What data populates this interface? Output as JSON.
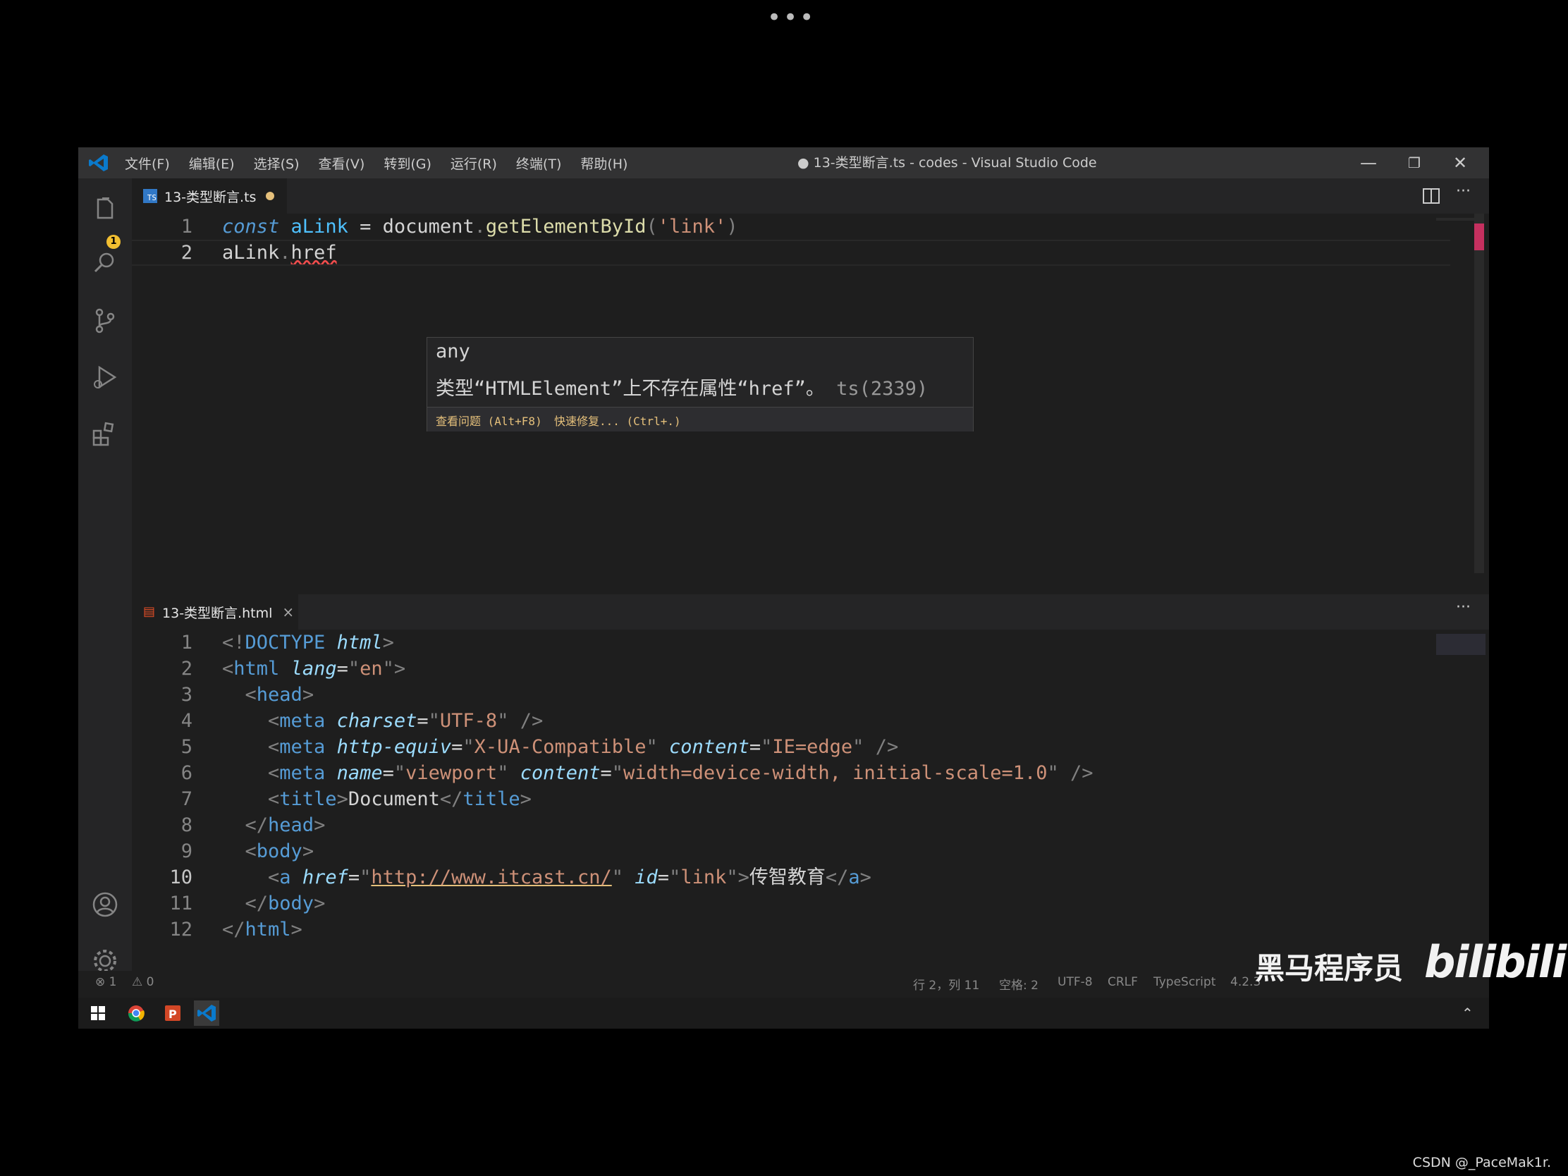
{
  "overlay": {
    "dots": "•••"
  },
  "titlebar": {
    "menu": [
      "文件(F)",
      "编辑(E)",
      "选择(S)",
      "查看(V)",
      "转到(G)",
      "运行(R)",
      "终端(T)",
      "帮助(H)"
    ],
    "title": "● 13-类型断言.ts - codes - Visual Studio Code",
    "minimize": "—",
    "restore": "❐",
    "close": "✕"
  },
  "activity": {
    "badge": "1"
  },
  "editor_top": {
    "tab_icon": "TS",
    "tab_name": "13-类型断言.ts",
    "lines": [
      {
        "num": "1",
        "tokens": [
          {
            "t": "const",
            "c": "kw"
          },
          {
            "t": " ",
            "c": "plain"
          },
          {
            "t": "aLink",
            "c": "var"
          },
          {
            "t": " = ",
            "c": "plain"
          },
          {
            "t": "document",
            "c": "plain"
          },
          {
            "t": ".",
            "c": "punc"
          },
          {
            "t": "getElementById",
            "c": "fn"
          },
          {
            "t": "(",
            "c": "punc"
          },
          {
            "t": "'link'",
            "c": "str"
          },
          {
            "t": ")",
            "c": "punc"
          }
        ]
      },
      {
        "num": "2",
        "tokens": [
          {
            "t": "aLink",
            "c": "plain"
          },
          {
            "t": ".",
            "c": "punc"
          },
          {
            "t": "href",
            "c": "plain squig"
          }
        ]
      }
    ],
    "hover": {
      "type": "any",
      "message_prefix": "类型“HTMLElement”上不存在属性“href”。",
      "message_code": "ts(2339)",
      "action_view": "查看问题 (Alt+F8)",
      "action_fix": "快速修复... (Ctrl+.)"
    }
  },
  "editor_bottom": {
    "tab_name": "13-类型断言.html",
    "tab_close": "×",
    "lines": [
      {
        "num": "1",
        "tokens": [
          {
            "t": "<!",
            "c": "punc"
          },
          {
            "t": "DOCTYPE",
            "c": "tag"
          },
          {
            "t": " ",
            "c": "plain"
          },
          {
            "t": "html",
            "c": "attr"
          },
          {
            "t": ">",
            "c": "punc"
          }
        ]
      },
      {
        "num": "2",
        "tokens": [
          {
            "t": "<",
            "c": "punc"
          },
          {
            "t": "html",
            "c": "tag"
          },
          {
            "t": " ",
            "c": "plain"
          },
          {
            "t": "lang",
            "c": "attr"
          },
          {
            "t": "=",
            "c": "plain"
          },
          {
            "t": "\"",
            "c": "punc"
          },
          {
            "t": "en",
            "c": "str"
          },
          {
            "t": "\"",
            "c": "punc"
          },
          {
            "t": ">",
            "c": "punc"
          }
        ]
      },
      {
        "num": "3",
        "tokens": [
          {
            "t": "  <",
            "c": "punc"
          },
          {
            "t": "head",
            "c": "tag"
          },
          {
            "t": ">",
            "c": "punc"
          }
        ]
      },
      {
        "num": "4",
        "tokens": [
          {
            "t": "    <",
            "c": "punc"
          },
          {
            "t": "meta",
            "c": "tag"
          },
          {
            "t": " ",
            "c": "plain"
          },
          {
            "t": "charset",
            "c": "attr"
          },
          {
            "t": "=",
            "c": "plain"
          },
          {
            "t": "\"",
            "c": "punc"
          },
          {
            "t": "UTF-8",
            "c": "str"
          },
          {
            "t": "\"",
            "c": "punc"
          },
          {
            "t": " />",
            "c": "punc"
          }
        ]
      },
      {
        "num": "5",
        "tokens": [
          {
            "t": "    <",
            "c": "punc"
          },
          {
            "t": "meta",
            "c": "tag"
          },
          {
            "t": " ",
            "c": "plain"
          },
          {
            "t": "http-equiv",
            "c": "attr"
          },
          {
            "t": "=",
            "c": "plain"
          },
          {
            "t": "\"",
            "c": "punc"
          },
          {
            "t": "X-UA-Compatible",
            "c": "str"
          },
          {
            "t": "\"",
            "c": "punc"
          },
          {
            "t": " ",
            "c": "plain"
          },
          {
            "t": "content",
            "c": "attr"
          },
          {
            "t": "=",
            "c": "plain"
          },
          {
            "t": "\"",
            "c": "punc"
          },
          {
            "t": "IE=edge",
            "c": "str"
          },
          {
            "t": "\"",
            "c": "punc"
          },
          {
            "t": " />",
            "c": "punc"
          }
        ]
      },
      {
        "num": "6",
        "tokens": [
          {
            "t": "    <",
            "c": "punc"
          },
          {
            "t": "meta",
            "c": "tag"
          },
          {
            "t": " ",
            "c": "plain"
          },
          {
            "t": "name",
            "c": "attr"
          },
          {
            "t": "=",
            "c": "plain"
          },
          {
            "t": "\"",
            "c": "punc"
          },
          {
            "t": "viewport",
            "c": "str"
          },
          {
            "t": "\"",
            "c": "punc"
          },
          {
            "t": " ",
            "c": "plain"
          },
          {
            "t": "content",
            "c": "attr"
          },
          {
            "t": "=",
            "c": "plain"
          },
          {
            "t": "\"",
            "c": "punc"
          },
          {
            "t": "width=device-width, initial-scale=1.0",
            "c": "str"
          },
          {
            "t": "\"",
            "c": "punc"
          },
          {
            "t": " />",
            "c": "punc"
          }
        ]
      },
      {
        "num": "7",
        "tokens": [
          {
            "t": "    <",
            "c": "punc"
          },
          {
            "t": "title",
            "c": "tag"
          },
          {
            "t": ">",
            "c": "punc"
          },
          {
            "t": "Document",
            "c": "plain"
          },
          {
            "t": "</",
            "c": "punc"
          },
          {
            "t": "title",
            "c": "tag"
          },
          {
            "t": ">",
            "c": "punc"
          }
        ]
      },
      {
        "num": "8",
        "tokens": [
          {
            "t": "  </",
            "c": "punc"
          },
          {
            "t": "head",
            "c": "tag"
          },
          {
            "t": ">",
            "c": "punc"
          }
        ]
      },
      {
        "num": "9",
        "tokens": [
          {
            "t": "  <",
            "c": "punc"
          },
          {
            "t": "body",
            "c": "tag"
          },
          {
            "t": ">",
            "c": "punc"
          }
        ]
      },
      {
        "num": "10",
        "tokens": [
          {
            "t": "    <",
            "c": "punc"
          },
          {
            "t": "a",
            "c": "tag"
          },
          {
            "t": " ",
            "c": "plain"
          },
          {
            "t": "href",
            "c": "attr"
          },
          {
            "t": "=",
            "c": "plain"
          },
          {
            "t": "\"",
            "c": "punc"
          },
          {
            "t": "http://www.itcast.cn/",
            "c": "url"
          },
          {
            "t": "\"",
            "c": "punc"
          },
          {
            "t": " ",
            "c": "plain"
          },
          {
            "t": "id",
            "c": "attr"
          },
          {
            "t": "=",
            "c": "plain"
          },
          {
            "t": "\"",
            "c": "punc"
          },
          {
            "t": "link",
            "c": "str"
          },
          {
            "t": "\"",
            "c": "punc"
          },
          {
            "t": ">",
            "c": "punc"
          },
          {
            "t": "传智教育",
            "c": "plain"
          },
          {
            "t": "</",
            "c": "punc"
          },
          {
            "t": "a",
            "c": "tag"
          },
          {
            "t": ">",
            "c": "punc"
          }
        ]
      },
      {
        "num": "11",
        "tokens": [
          {
            "t": "  </",
            "c": "punc"
          },
          {
            "t": "body",
            "c": "tag"
          },
          {
            "t": ">",
            "c": "punc"
          }
        ]
      },
      {
        "num": "12",
        "tokens": [
          {
            "t": "</",
            "c": "punc"
          },
          {
            "t": "html",
            "c": "tag"
          },
          {
            "t": ">",
            "c": "punc"
          }
        ]
      }
    ]
  },
  "statusbar": {
    "errors": "⊗ 1",
    "warnings": "⚠ 0",
    "position": "行 2，列 11",
    "spaces": "空格: 2",
    "encoding": "UTF-8",
    "eol": "CRLF",
    "language": "TypeScript",
    "version": "4.2.3"
  },
  "watermark": {
    "text": "黑马程序员",
    "logo": "bilibili"
  },
  "credit": "CSDN @_PaceMak1r."
}
